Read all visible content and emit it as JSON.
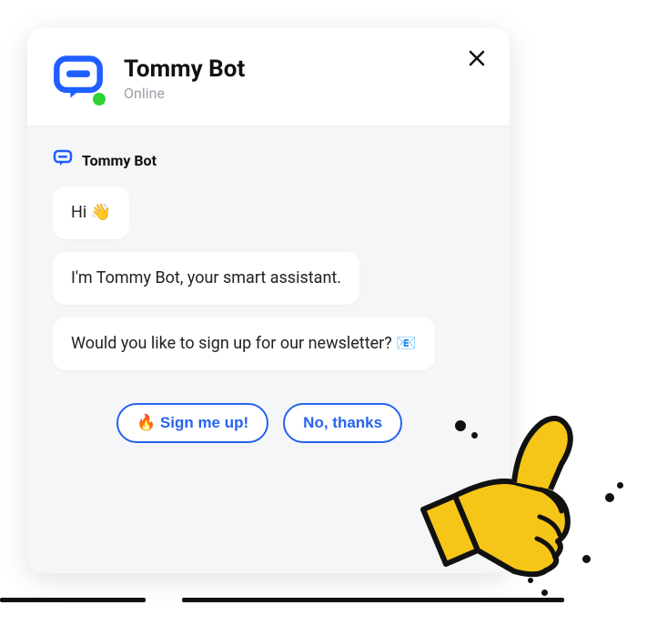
{
  "header": {
    "title": "Tommy Bot",
    "status": "Online"
  },
  "sender_name": "Tommy Bot",
  "messages": [
    "Hi 👋",
    "I'm Tommy Bot, your smart assistant.",
    "Would you like to sign up for our newsletter? 📧"
  ],
  "buttons": {
    "signup": "🔥 Sign me up!",
    "decline": "No, thanks"
  }
}
